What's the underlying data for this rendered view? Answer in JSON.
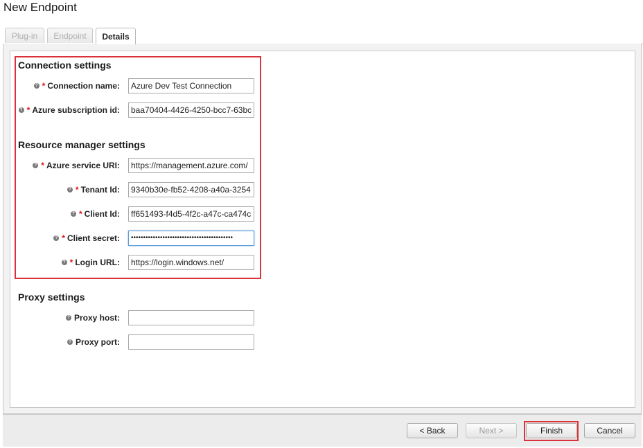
{
  "window": {
    "title": "New Endpoint"
  },
  "tabs": [
    {
      "label": "Plug-in",
      "active": false
    },
    {
      "label": "Endpoint",
      "active": false
    },
    {
      "label": "Details",
      "active": true
    }
  ],
  "connection_settings": {
    "heading": "Connection settings",
    "connection_name": {
      "label": "Connection name:",
      "value": "Azure Dev Test Connection",
      "required": true
    },
    "subscription_id": {
      "label": "Azure subscription id:",
      "value": "baa70404-4426-4250-bcc7-63bc",
      "required": true
    }
  },
  "resource_manager_settings": {
    "heading": "Resource manager settings",
    "service_uri": {
      "label": "Azure service URI:",
      "value": "https://management.azure.com/",
      "required": true
    },
    "tenant_id": {
      "label": "Tenant Id:",
      "value": "9340b30e-fb52-4208-a40a-3254",
      "required": true
    },
    "client_id": {
      "label": "Client Id:",
      "value": "ff651493-f4d5-4f2c-a47c-ca474c",
      "required": true
    },
    "client_secret": {
      "label": "Client secret:",
      "value": "••••••••••••••••••••••••••••••••••••••••••",
      "required": true
    },
    "login_url": {
      "label": "Login URL:",
      "value": "https://login.windows.net/",
      "required": true
    }
  },
  "proxy_settings": {
    "heading": "Proxy settings",
    "proxy_host": {
      "label": "Proxy host:",
      "value": ""
    },
    "proxy_port": {
      "label": "Proxy port:",
      "value": ""
    }
  },
  "help_glyph": "?",
  "required_marker": "*",
  "buttons": {
    "back": "< Back",
    "next": "Next >",
    "finish": "Finish",
    "cancel": "Cancel"
  },
  "colors": {
    "highlight": "#d9323b",
    "required": "#dd1111",
    "focus_border": "#5d9bd8"
  }
}
